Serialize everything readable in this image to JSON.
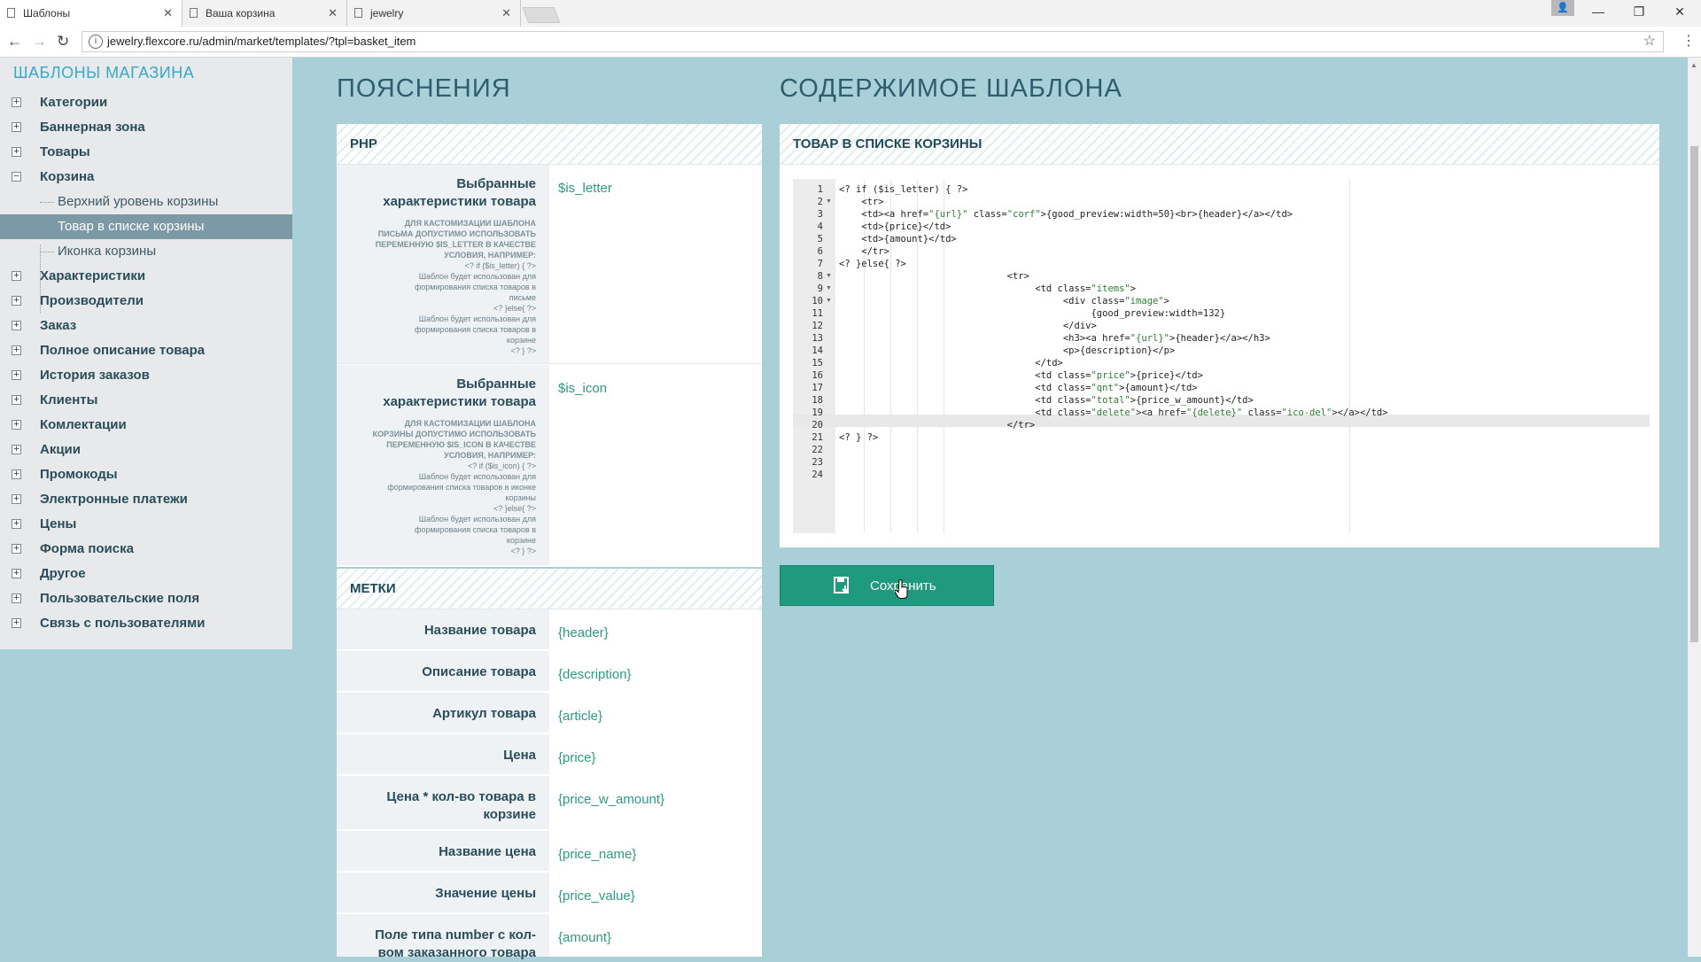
{
  "browser": {
    "tabs": [
      {
        "label": "Шаблоны",
        "active": true
      },
      {
        "label": "Ваша корзина",
        "active": false
      },
      {
        "label": "jewelry",
        "active": false
      }
    ],
    "url": "jewelry.flexcore.ru/admin/market/templates/?tpl=basket_item"
  },
  "sidebar": {
    "title": "ШАБЛОНЫ МАГАЗИНА",
    "items": [
      {
        "label": "Категории",
        "toggle": "+"
      },
      {
        "label": "Баннерная зона",
        "toggle": "+"
      },
      {
        "label": "Товары",
        "toggle": "+"
      },
      {
        "label": "Корзина",
        "toggle": "−"
      },
      {
        "label": "Характеристики",
        "toggle": "+"
      },
      {
        "label": "Производители",
        "toggle": "+"
      },
      {
        "label": "Заказ",
        "toggle": "+"
      },
      {
        "label": "Полное описание товара",
        "toggle": "+"
      },
      {
        "label": "История заказов",
        "toggle": "+"
      },
      {
        "label": "Клиенты",
        "toggle": "+"
      },
      {
        "label": "Комлектации",
        "toggle": "+"
      },
      {
        "label": "Акции",
        "toggle": "+"
      },
      {
        "label": "Промокоды",
        "toggle": "+"
      },
      {
        "label": "Электронные платежи",
        "toggle": "+"
      },
      {
        "label": "Цены",
        "toggle": "+"
      },
      {
        "label": "Форма поиска",
        "toggle": "+"
      },
      {
        "label": "Другое",
        "toggle": "+"
      },
      {
        "label": "Пользовательские поля",
        "toggle": "+"
      },
      {
        "label": "Связь с пользователями",
        "toggle": "+"
      }
    ],
    "sub_items": [
      {
        "label": "Верхний уровень корзины"
      },
      {
        "label": "Товар в списке корзины"
      },
      {
        "label": "Иконка корзины"
      }
    ]
  },
  "explanations": {
    "heading": "ПОЯСНЕНИЯ",
    "php": {
      "title": "PHP",
      "rows": [
        {
          "name_l1": "Выбранные",
          "name_l2": "характеристики товара",
          "desc_caps": [
            "ДЛЯ КАСТОМИЗАЦИИ ШАБЛОНА",
            "ПИСЬМА ДОПУСТИМО ИСПОЛЬЗОВАТЬ",
            "ПЕРЕМЕННУЮ $IS_LETTER В КАЧЕСТВЕ",
            "УСЛОВИЯ, НАПРИМЕР:"
          ],
          "desc_lines": [
            "<? if ($is_letter) { ?>",
            "Шаблон будет использован для",
            "формирования списка товаров в",
            "письме",
            "<? }else{ ?>",
            "Шаблон будет использован для",
            "формирования списка товаров в",
            "корзине",
            "<? } ?>"
          ],
          "value": "$is_letter"
        },
        {
          "name_l1": "Выбранные",
          "name_l2": "характеристики товара",
          "desc_caps": [
            "ДЛЯ КАСТОМИЗАЦИИ ШАБЛОНА",
            "КОРЗИНЫ ДОПУСТИМО ИСПОЛЬЗОВАТЬ",
            "ПЕРЕМЕННУЮ $IS_ICON В КАЧЕСТВЕ",
            "УСЛОВИЯ, НАПРИМЕР:"
          ],
          "desc_lines": [
            "<? if ($is_icon) { ?>",
            "Шаблон будет использован для",
            "формирования списка товаров в иконке",
            "корзины",
            "<? }else{ ?>",
            "Шаблон будет использован для",
            "формирования списка товаров в",
            "корзине",
            "<? } ?>"
          ],
          "value": "$is_icon"
        }
      ]
    },
    "marks": {
      "title": "МЕТКИ",
      "rows": [
        {
          "name": "Название товара",
          "value": "{header}"
        },
        {
          "name": "Описание товара",
          "value": "{description}"
        },
        {
          "name": "Артикул товара",
          "value": "{article}"
        },
        {
          "name": "Цена",
          "value": "{price}"
        },
        {
          "name_l1": "Цена * кол-во товара в",
          "name_l2": "корзине",
          "value": "{price_w_amount}"
        },
        {
          "name": "Название цена",
          "value": "{price_name}"
        },
        {
          "name": "Значение цены",
          "value": "{price_value}"
        },
        {
          "name_l1": "Поле типа number с кол-",
          "name_l2": "вом заказанного товара",
          "value": "{amount}"
        }
      ]
    }
  },
  "template": {
    "heading": "СОДЕРЖИМОЕ ШАБЛОНА",
    "panel_title": "ТОВАР В СПИСКЕ КОРЗИНЫ",
    "code_lines": [
      "<? if ($is_letter) { ?>",
      "    <tr>",
      "    <td><a href=\"{url}\" class=\"corf\">{good_preview:width=50}<br>{header}</a></td>",
      "    <td>{price}</td>",
      "    <td>{amount}</td>",
      "    </tr>",
      "<? }else{ ?>",
      "                              <tr>",
      "                                   <td class=\"items\">",
      "                                        <div class=\"image\">",
      "                                             {good_preview:width=132}",
      "                                        </div>",
      "                                        <h3><a href=\"{url}\">{header}</a></h3>",
      "                                        <p>{description}</p>",
      "                                   </td>",
      "                                   <td class=\"price\">{price}</td>",
      "                                   <td class=\"qnt\">{amount}</td>",
      "                                   <td class=\"total\">{price_w_amount}</td>",
      "                                   <td class=\"delete\"><a href=\"{delete}\" class=\"ico-del\"></a></td>",
      "                              </tr>",
      "<? } ?>",
      "",
      "",
      ""
    ],
    "line_numbers": [
      "1",
      "2",
      "3",
      "4",
      "5",
      "6",
      "7",
      "8",
      "9",
      "10",
      "11",
      "12",
      "13",
      "14",
      "15",
      "16",
      "17",
      "18",
      "19",
      "20",
      "21",
      "22",
      "23",
      "24"
    ],
    "fold_lines": [
      2,
      8,
      9,
      10
    ],
    "highlighted_line": 19,
    "save_label": "Сохранить"
  },
  "colors": {
    "background": "#a9cfd8",
    "accent_green": "#1f9a7e",
    "sidebar_active": "#7b9aa6",
    "title_blue": "#37a9c9",
    "heading": "#2d5e70"
  }
}
